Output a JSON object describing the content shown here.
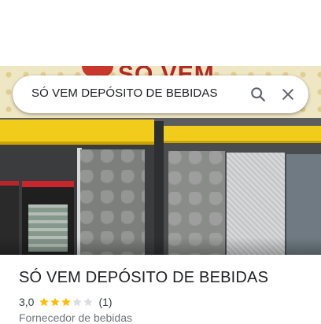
{
  "search": {
    "query": "SÓ VEM DEPÓSITO DE BEBIDAS"
  },
  "photo": {
    "sign_text": "SÓ VEM"
  },
  "place": {
    "name": "SÓ VEM DEPÓSITO DE BEBIDAS",
    "rating": "3,0",
    "rating_value": 3.0,
    "rating_max": 5,
    "review_count": "(1)",
    "category": "Fornecedor de bebidas"
  },
  "icons": {
    "search": "search-icon",
    "close": "close-icon",
    "star": "star-icon"
  },
  "colors": {
    "star_filled": "#fbbc04",
    "star_empty": "#dadce0",
    "title_text": "#202124",
    "secondary_text": "#70757a",
    "awning_yellow": "#f2cc1b"
  }
}
